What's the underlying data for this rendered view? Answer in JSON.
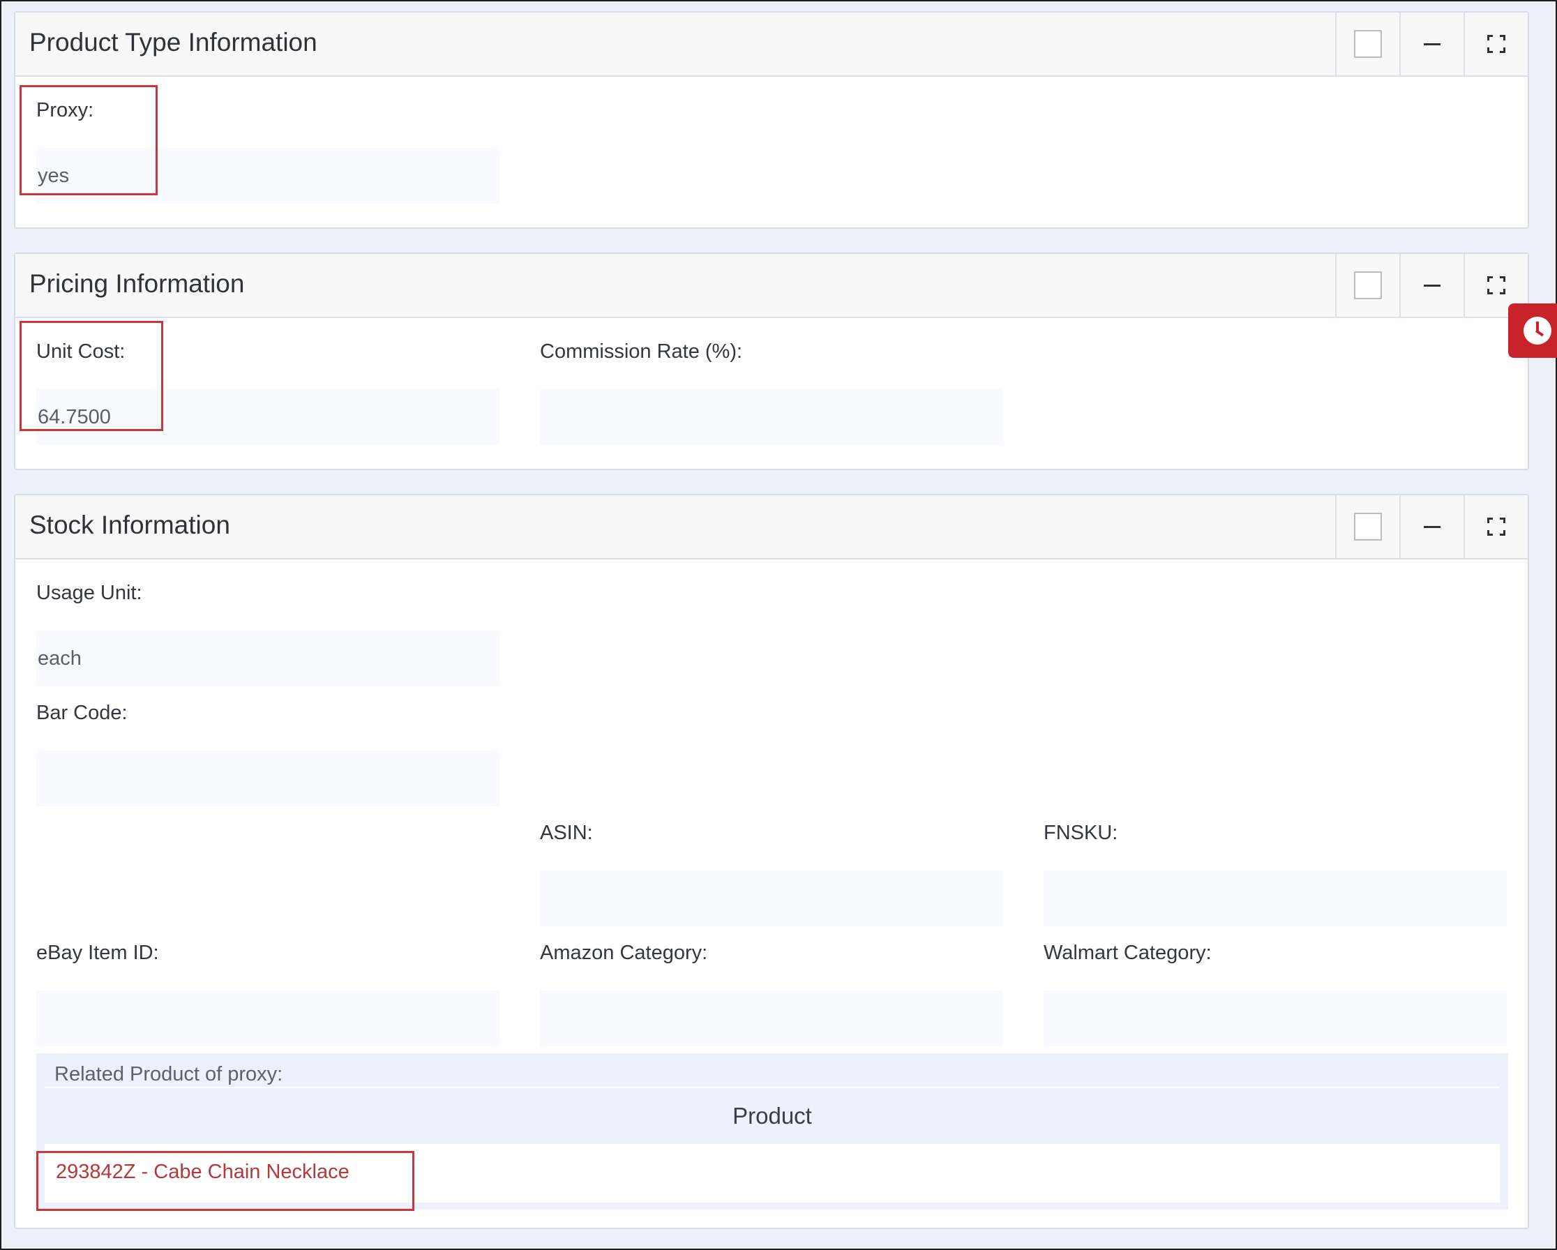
{
  "panels": {
    "product_type": {
      "title": "Product Type Information",
      "fields": {
        "proxy": {
          "label": "Proxy:",
          "value": "yes"
        }
      }
    },
    "pricing": {
      "title": "Pricing Information",
      "fields": {
        "unit_cost": {
          "label": "Unit Cost:",
          "value": "64.7500"
        },
        "commission_rate": {
          "label": "Commission Rate (%):",
          "value": ""
        }
      }
    },
    "stock": {
      "title": "Stock Information",
      "fields": {
        "usage_unit": {
          "label": "Usage Unit:",
          "value": "each"
        },
        "bar_code": {
          "label": "Bar Code:",
          "value": ""
        },
        "asin": {
          "label": "ASIN:",
          "value": ""
        },
        "fnsku": {
          "label": "FNSKU:",
          "value": ""
        },
        "ebay_item_id": {
          "label": "eBay Item ID:",
          "value": ""
        },
        "amazon_category": {
          "label": "Amazon Category:",
          "value": ""
        },
        "walmart_category": {
          "label": "Walmart Category:",
          "value": ""
        }
      },
      "related": {
        "label": "Related Product of proxy:",
        "column_header": "Product",
        "rows": [
          {
            "product": "293842Z - Cabe Chain Necklace"
          }
        ]
      }
    }
  },
  "icons": {
    "checkbox": "checkbox-icon",
    "minimize": "minus-icon",
    "maximize": "expand-icon",
    "clock": "clock-icon"
  },
  "colors": {
    "highlight": "#c7383b",
    "clock_tab": "#c8232b",
    "link": "#b5393c",
    "input_bg": "#f8faff"
  }
}
